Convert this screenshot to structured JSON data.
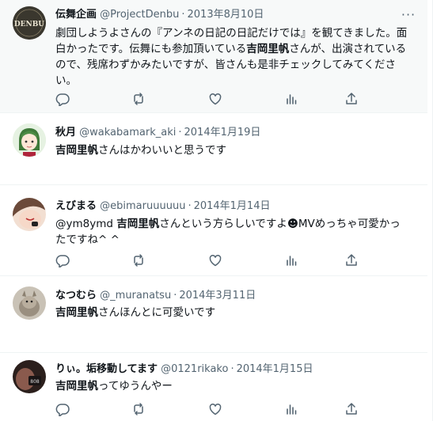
{
  "tweets": [
    {
      "name": "伝舞企画",
      "handle": "@ProjectDenbu",
      "date": "2013年8月10日",
      "avatar_text": "DENBU",
      "body_parts": [
        {
          "text": "劇団しようよさんの『アンネの日記の日記だけでは』を観てきました。面白かったです。伝舞にも参加頂いている",
          "bold": false
        },
        {
          "text": "吉岡里帆",
          "bold": true
        },
        {
          "text": "さんが、出演されているので、残席わずかみたいですが、皆さんも是非チェックしてみてください。",
          "bold": false
        }
      ]
    },
    {
      "name": "秋月",
      "handle": "@wakabamark_aki",
      "date": "2014年1月19日",
      "body_parts": [
        {
          "text": "吉岡里帆",
          "bold": true
        },
        {
          "text": "さんはかわいいと思うです",
          "bold": false
        }
      ]
    },
    {
      "name": "えびまる",
      "handle": "@ebimaruuuuuu",
      "date": "2014年1月14日",
      "body_parts": [
        {
          "text": "@ym8ymd ",
          "bold": false
        },
        {
          "text": "吉岡里帆",
          "bold": true
        },
        {
          "text": "さんという方らしいですよ☻MVめっちゃ可愛かったですね^ ^",
          "bold": false
        }
      ]
    },
    {
      "name": "なつむら",
      "handle": "@_muranatsu",
      "date": "2014年3月11日",
      "body_parts": [
        {
          "text": "吉岡里帆",
          "bold": true
        },
        {
          "text": "さんほんとに可愛いです",
          "bold": false
        }
      ]
    },
    {
      "name": "りぃ。垢移動してます",
      "handle": "@0121rikako",
      "date": "2014年1月15日",
      "avatar_text": "808",
      "body_parts": [
        {
          "text": "吉岡里帆",
          "bold": true
        },
        {
          "text": "ってゆうんやー",
          "bold": false
        }
      ]
    }
  ],
  "separator": "·",
  "more_glyph": "···",
  "icons": [
    "reply-icon",
    "retweet-icon",
    "like-icon",
    "analytics-icon",
    "share-icon"
  ],
  "colors": {
    "text": "#0f1419",
    "muted": "#536471",
    "divider": "#eff3f4"
  }
}
